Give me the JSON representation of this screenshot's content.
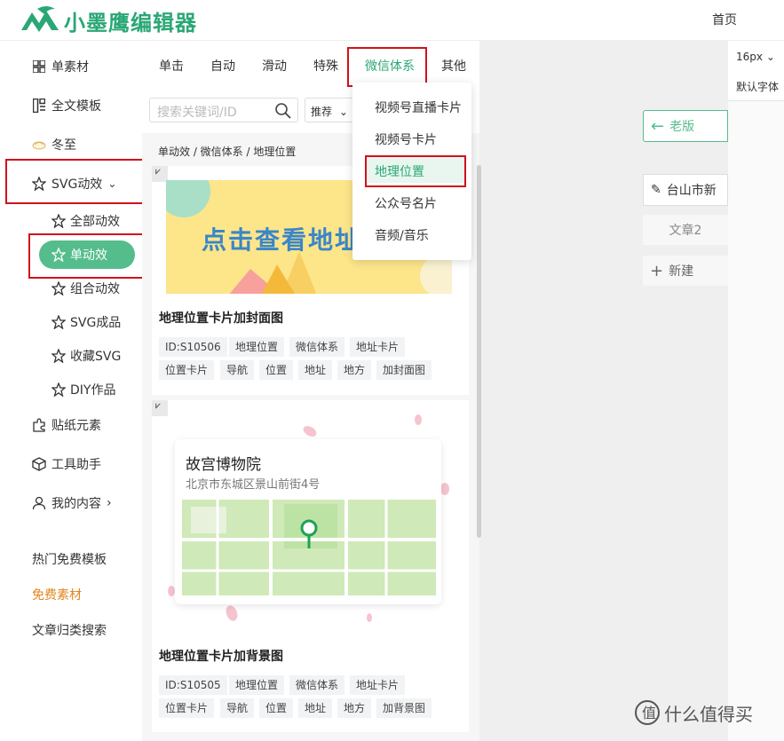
{
  "header": {
    "logo_text": "小墨鹰编辑器",
    "home": "首页"
  },
  "sidebar": {
    "items": [
      {
        "label": "单素材",
        "icon": "grid-icon"
      },
      {
        "label": "全文模板",
        "icon": "template-icon"
      },
      {
        "label": "冬至",
        "icon": "dumpling-icon"
      },
      {
        "label": "SVG动效",
        "icon": "svg-star-icon"
      }
    ],
    "svg_sub": [
      "全部动效",
      "单动效",
      "组合动效",
      "SVG成品",
      "收藏SVG",
      "DIY作品"
    ],
    "items2": [
      {
        "label": "贴纸元素",
        "icon": "puzzle-icon"
      },
      {
        "label": "工具助手",
        "icon": "cube-icon"
      },
      {
        "label": "我的内容",
        "icon": "user-icon"
      }
    ],
    "links": [
      "热门免费模板",
      "免费素材",
      "文章归类搜索"
    ]
  },
  "tabs": [
    "单击",
    "自动",
    "滑动",
    "特殊",
    "微信体系",
    "其他"
  ],
  "search": {
    "placeholder": "搜索关键词/ID",
    "sort": "推荐"
  },
  "breadcrumb": "单动效 / 微信体系 / 地理位置",
  "dropdown": [
    "视频号直播卡片",
    "视频号卡片",
    "地理位置",
    "公众号名片",
    "音频/音乐"
  ],
  "cards": [
    {
      "banner_text": "点击查看地址",
      "title": "地理位置卡片加封面图",
      "tags": [
        "ID:S10506",
        "地理位置",
        "微信体系",
        "地址卡片",
        "位置卡片",
        "导航",
        "位置",
        "地址",
        "地方",
        "加封面图"
      ]
    },
    {
      "map_title": "故宫博物院",
      "map_address": "北京市东城区景山前街4号",
      "title": "地理位置卡片加背景图",
      "tags": [
        "ID:S10505",
        "地理位置",
        "微信体系",
        "地址卡片",
        "位置卡片",
        "导航",
        "位置",
        "地址",
        "地方",
        "加背景图"
      ]
    }
  ],
  "right": {
    "old_version": "老版",
    "doc1": "台山市新",
    "doc2": "文章2",
    "new_doc": "新建",
    "font_size": "16px",
    "font_family": "默认字体"
  },
  "watermark": "什么值得买",
  "colors": {
    "brand": "#2aa775",
    "accent": "#55bd8c",
    "highlight_box": "#d0121b"
  }
}
